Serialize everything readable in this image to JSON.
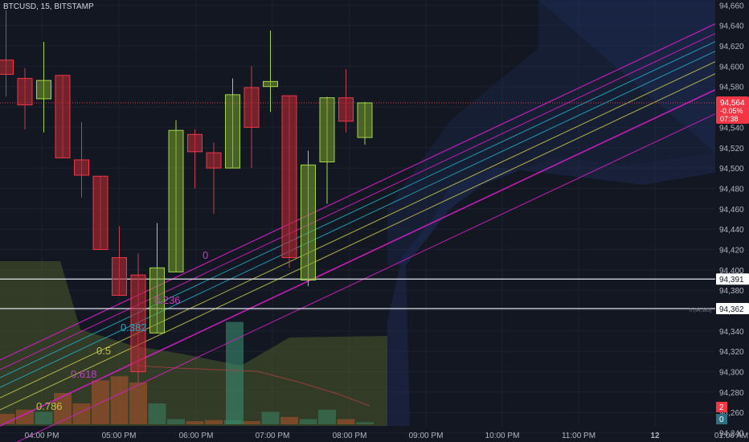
{
  "header": {
    "symbol": "BTCUSD, 15, BITSTAMP"
  },
  "colors": {
    "background": "#131722",
    "up": "#a5d64a",
    "down": "#f23645",
    "fib_magenta": "#d61fc6",
    "fib_cyan": "#22a9c4",
    "fib_yellow": "#c2c24a",
    "cloud_olive": "#4a5a2a",
    "cloud_blue": "#1e2a52"
  },
  "price_badge": {
    "price": "94,564",
    "change": "-0.05%",
    "countdown": "07:38"
  },
  "level_labels": [
    {
      "text": "94,391"
    },
    {
      "text": "94,362"
    }
  ],
  "side_badges": [
    "2",
    "0"
  ],
  "small_note": "0 (94,363)",
  "chart_data": {
    "type": "candlestick",
    "title": "",
    "y_ticks": [
      "94,660",
      "94,640",
      "94,620",
      "94,600",
      "94,580",
      "94,560",
      "94,540",
      "94,520",
      "94,500",
      "94,480",
      "94,460",
      "94,440",
      "94,420",
      "94,400",
      "94,380",
      "94,360",
      "94,340",
      "94,320",
      "94,300",
      "94,280",
      "94,260",
      "94,240"
    ],
    "x_ticks": [
      "04:00 PM",
      "05:00 PM",
      "06:00 PM",
      "07:00 PM",
      "08:00 PM",
      "09:00 PM",
      "10:00 PM",
      "11:00 PM",
      "12",
      "01:00 AM"
    ],
    "ylim": [
      94231,
      94665
    ],
    "candles": [
      {
        "o": 94606,
        "h": 94655,
        "c": 94592,
        "l": 94570
      },
      {
        "o": 94588,
        "h": 94598,
        "c": 94562,
        "l": 94538
      },
      {
        "o": 94568,
        "h": 94624,
        "c": 94586,
        "l": 94535
      },
      {
        "o": 94591,
        "h": 94591,
        "c": 94510,
        "l": 94510
      },
      {
        "o": 94508,
        "h": 94545,
        "c": 94493,
        "l": 94471
      },
      {
        "o": 94492,
        "h": 94492,
        "c": 94420,
        "l": 94420
      },
      {
        "o": 94412,
        "h": 94443,
        "c": 94375,
        "l": 94375
      },
      {
        "o": 94395,
        "h": 94416,
        "c": 94300,
        "l": 94289
      },
      {
        "o": 94338,
        "h": 94446,
        "c": 94402,
        "l": 94338
      },
      {
        "o": 94398,
        "h": 94547,
        "c": 94537,
        "l": 94398
      },
      {
        "o": 94533,
        "h": 94538,
        "c": 94516,
        "l": 94480
      },
      {
        "o": 94515,
        "h": 94525,
        "c": 94500,
        "l": 94455
      },
      {
        "o": 94500,
        "h": 94588,
        "c": 94572,
        "l": 94500
      },
      {
        "o": 94579,
        "h": 94600,
        "c": 94540,
        "l": 94500
      },
      {
        "o": 94580,
        "h": 94635,
        "c": 94585,
        "l": 94555
      },
      {
        "o": 94571,
        "h": 94571,
        "c": 94412,
        "l": 94402
      },
      {
        "o": 94390,
        "h": 94517,
        "c": 94503,
        "l": 94384
      },
      {
        "o": 94506,
        "h": 94570,
        "c": 94569,
        "l": 94465
      },
      {
        "o": 94569,
        "h": 94597,
        "c": 94546,
        "l": 94535
      },
      {
        "o": 94530,
        "h": 94565,
        "c": 94564,
        "l": 94523
      }
    ],
    "volume": [
      0.1,
      0.14,
      0.12,
      0.3,
      0.2,
      0.42,
      0.46,
      0.4,
      0.2,
      0.05,
      0.03,
      0.04,
      0.04,
      0.03,
      0.12,
      0.07,
      0.05,
      0.14,
      0.05,
      0.02
    ],
    "volume_big": 0.98,
    "fib_levels": [
      "0",
      "0.236",
      "0.382",
      "0.5",
      "0.618",
      "0.786"
    ],
    "horizontal_levels": [
      94391,
      94362
    ],
    "current_price": 94564
  }
}
